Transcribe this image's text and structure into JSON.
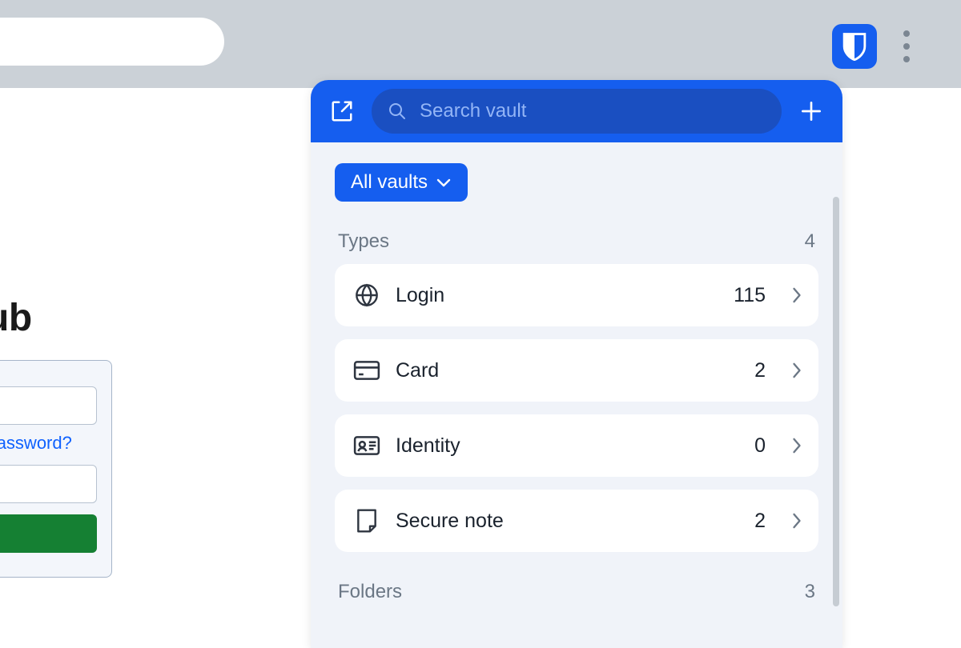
{
  "browser": {
    "extension_name": "bitwarden-extension"
  },
  "underlying_page": {
    "title_fragment": "ub",
    "forgot_password_fragment": "ot password?"
  },
  "popup": {
    "search_placeholder": "Search vault",
    "vault_selector_label": "All vaults",
    "sections": {
      "types": {
        "label": "Types",
        "count": 4,
        "items": [
          {
            "label": "Login",
            "count": 115,
            "icon": "globe-icon"
          },
          {
            "label": "Card",
            "count": 2,
            "icon": "card-icon"
          },
          {
            "label": "Identity",
            "count": 0,
            "icon": "identity-icon"
          },
          {
            "label": "Secure note",
            "count": 2,
            "icon": "note-icon"
          }
        ]
      },
      "folders": {
        "label": "Folders",
        "count": 3
      }
    }
  }
}
